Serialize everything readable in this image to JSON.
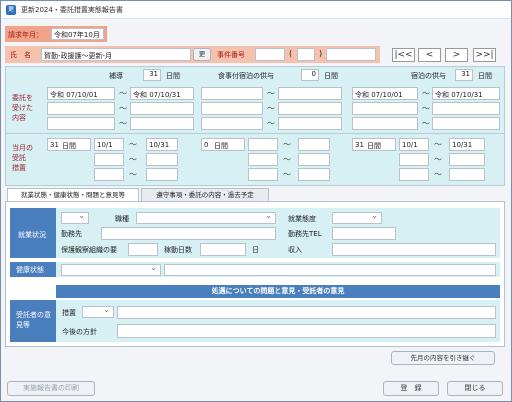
{
  "window": {
    "title": "更新2024・委託措置実態報告書"
  },
  "header": {
    "request_label": "請求年月：",
    "request_value": "令和07年10月",
    "name_label": "氏　名",
    "name_value": "賀勤-政援護〜更新-月",
    "name_button": "更",
    "case_label": "事件番号",
    "case_paren_open": "(",
    "case_paren_close": ")"
  },
  "nav": {
    "first": "|<<",
    "prev": "<",
    "next": ">",
    "last": ">>|"
  },
  "summary": {
    "col1_label": "補導",
    "col1_value": "31",
    "col1_unit": "日間",
    "col2_label": "食事付宿泊の供与",
    "col2_value": "0",
    "col2_unit": "日間",
    "col3_label": "宿泊の供与",
    "col3_value": "31",
    "col3_unit": "日間"
  },
  "commission": {
    "row_label_lines": [
      "委託を",
      "受けた",
      "内容"
    ],
    "col1_from": "令和 07/10/01",
    "col1_to": "令和 07/10/31",
    "col3_from": "令和 07/10/01",
    "col3_to": "令和 07/10/31",
    "tilde": "〜"
  },
  "current": {
    "row_label_lines": [
      "当月の",
      "受託",
      "措置"
    ],
    "col1_days": "31",
    "col1_unit": "日間",
    "col1_from": "10/1",
    "col1_to": "10/31",
    "col2_days": "0",
    "col2_unit": "日間",
    "col3_days": "31",
    "col3_unit": "日間",
    "col3_from": "10/1",
    "col3_to": "10/31",
    "tilde": "〜"
  },
  "tabs": [
    {
      "label": "就業状態・健康状態・問題と意見等"
    },
    {
      "label": "遵守事項・委託の内容・過去予定"
    }
  ],
  "employment": {
    "section_label": "就業状況",
    "job_label": "職種",
    "form_label": "就業態度",
    "workplace_label": "勤務先",
    "workplace_tel_label": "勤務先TEL",
    "guardian_label": "保護観察組織の要",
    "days_label": "稼動日数",
    "days_unit": "日",
    "income_label": "収入"
  },
  "health": {
    "label": "健康状態"
  },
  "opinion": {
    "header": "処遇についての問題と意見・受託者の意見",
    "section_label_lines": [
      "受託者の意",
      "見等"
    ],
    "measure_label": "措置",
    "future_label": "今後の方針"
  },
  "buttons": {
    "carry_over": "先月の内容を引き継ぐ",
    "print": "実施報告書の印刷",
    "register": "登　録",
    "close": "閉じる"
  }
}
